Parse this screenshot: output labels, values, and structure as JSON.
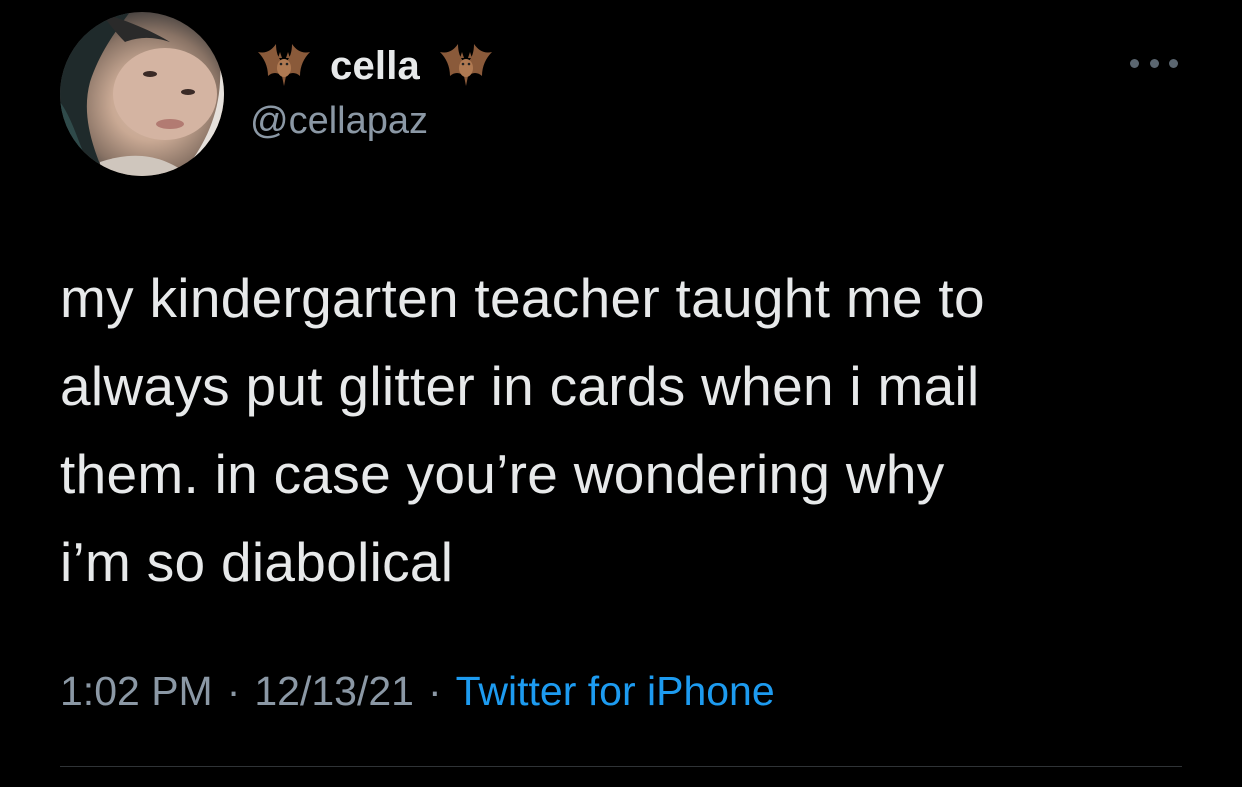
{
  "tweet": {
    "author": {
      "display_name": "cella",
      "handle": "@cellapaz",
      "name_decoration_icon": "bat-emoji"
    },
    "text_lines": [
      "my kindergarten teacher taught me to",
      "always put glitter in cards when i mail",
      "them. in case you’re wondering why",
      "i’m so diabolical"
    ],
    "meta": {
      "time": "1:02 PM",
      "separator": "·",
      "date": "12/13/21",
      "source": "Twitter for iPhone"
    },
    "more_icon": "more-horizontal-icon"
  },
  "colors": {
    "background": "#000000",
    "primary_text": "#e7e9ea",
    "secondary_text": "#8b98a5",
    "link": "#1d9bf0",
    "divider": "#2f3336"
  }
}
